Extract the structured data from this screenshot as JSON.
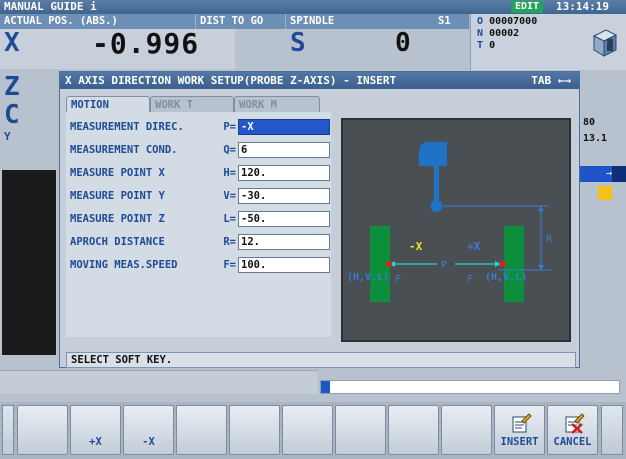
{
  "header": {
    "mode_title": "MANUAL GUIDE i",
    "edit_badge": "EDIT",
    "clock": "13:14:19"
  },
  "position_panel": {
    "title": "ACTUAL POS. (ABS.)",
    "dist_to_go_label": "DIST TO GO",
    "axes": [
      "X",
      "Z",
      "C",
      "Y"
    ],
    "x_value": "-0.996"
  },
  "spindle_panel": {
    "title": "SPINDLE",
    "spindle_id": "S1",
    "letter": "S",
    "value": "0"
  },
  "program_panel": {
    "o_label": "O",
    "o_value": "00007000",
    "n_label": "N",
    "n_value": "00002",
    "t_label": "T",
    "t_value": "0"
  },
  "right_side": {
    "value1": "80",
    "value2": "13.1",
    "blue_arrow": "→"
  },
  "dialog": {
    "title": "X AXIS DIRECTION WORK SETUP(PROBE Z-AXIS) - INSERT",
    "tab_hint": "TAB ←→",
    "tabs": [
      "MOTION",
      "WORK T",
      "WORK M"
    ],
    "rows": [
      {
        "label": "MEASUREMENT DIREC.",
        "code": "P=",
        "value": "-X"
      },
      {
        "label": "MEASUREMENT COND.",
        "code": "Q=",
        "value": "6"
      },
      {
        "label": "MEASURE POINT X",
        "code": "H=",
        "value": "120."
      },
      {
        "label": "MEASURE POINT Y",
        "code": "V=",
        "value": "-30."
      },
      {
        "label": "MEASURE POINT Z",
        "code": "L=",
        "value": "-50."
      },
      {
        "label": "APROCH DISTANCE",
        "code": "R=",
        "value": "12."
      },
      {
        "label": "MOVING MEAS.SPEED",
        "code": "F=",
        "value": "100."
      }
    ],
    "diagram": {
      "minus_x": "-X",
      "plus_x": "+X",
      "p": "P",
      "r": "R",
      "f_left": "F",
      "f_right": "F",
      "point_left": "(H,V,L)",
      "point_right": "(H,V,L)"
    },
    "status": "SELECT SOFT KEY."
  },
  "progress": {
    "fraction": 0.03
  },
  "softkeys": [
    "",
    "+X",
    "-X",
    "",
    "",
    "",
    "",
    "",
    "",
    "INSERT",
    "CANCEL"
  ]
}
